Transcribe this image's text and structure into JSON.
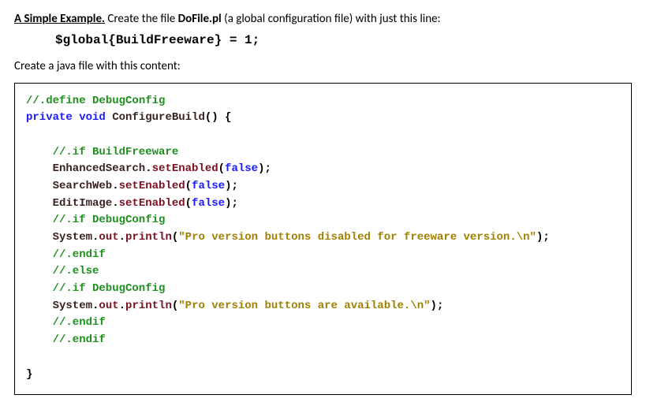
{
  "intro": {
    "heading": "A Simple Example.",
    "text_before_bold": "  Create the file ",
    "bold_filename": "DoFile.pl",
    "text_after_bold": " (a global configuration file) with just this line:"
  },
  "config_line": "$global{BuildFreeware} = 1;",
  "second_para": "Create a java file with this content:",
  "code": {
    "l01": "//.define DebugConfig",
    "l02a": "private",
    "l02b": "void",
    "l02c": "ConfigureBuild",
    "l02d": "() {",
    "l04": "//.if BuildFreeware",
    "l05a": "EnhancedSearch",
    "l05b": "setEnabled",
    "l05c": "false",
    "l06a": "SearchWeb",
    "l06b": "setEnabled",
    "l06c": "false",
    "l07a": "EditImage",
    "l07b": "setEnabled",
    "l07c": "false",
    "l08": "//.if DebugConfig",
    "l09a": "System",
    "l09b": "out",
    "l09c": "println",
    "l09d": "\"Pro version buttons disabled for freeware version.\\n\"",
    "l10": "//.endif",
    "l11": "//.else",
    "l12": "//.if DebugConfig",
    "l13a": "System",
    "l13b": "out",
    "l13c": "println",
    "l13d": "\"Pro version buttons are available.\\n\"",
    "l14": "//.endif",
    "l15": "//.endif",
    "l17": "}"
  }
}
